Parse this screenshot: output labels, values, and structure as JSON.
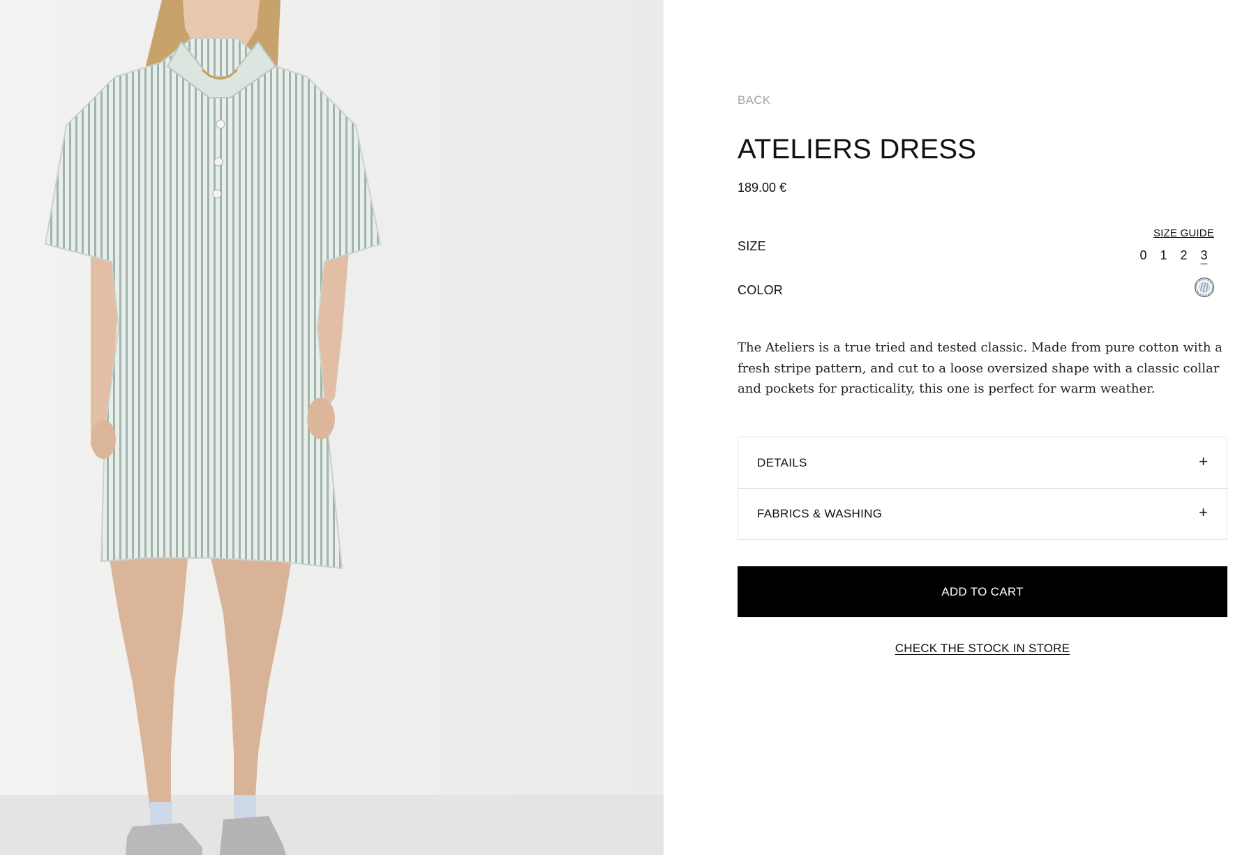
{
  "navigation": {
    "back_label": "BACK"
  },
  "product": {
    "title": "ATELIERS DRESS",
    "price": "189.00 €",
    "image_alt": "Model wearing striped shirt dress",
    "description": "The Ateliers is a true tried and tested classic. Made from pure cotton with a fresh stripe pattern, and cut to a loose oversized shape with a classic collar and pockets for practicality, this one is perfect for warm weather."
  },
  "size": {
    "label": "SIZE",
    "guide_label": "SIZE GUIDE",
    "options": [
      "0",
      "1",
      "2",
      "3"
    ],
    "selected": "3"
  },
  "color": {
    "label": "COLOR",
    "swatch_colors": [
      "#dfe6ee",
      "#9eb0c8"
    ]
  },
  "accordion": [
    {
      "label": "DETAILS",
      "icon": "plus-icon"
    },
    {
      "label": "FABRICS & WASHING",
      "icon": "plus-icon"
    }
  ],
  "actions": {
    "add_to_cart_label": "ADD TO CART",
    "check_stock_label": "CHECK THE STOCK IN STORE"
  },
  "colors": {
    "image_background": "#eeeeed",
    "button_background": "#000000",
    "muted_text": "#a4a4a4"
  }
}
